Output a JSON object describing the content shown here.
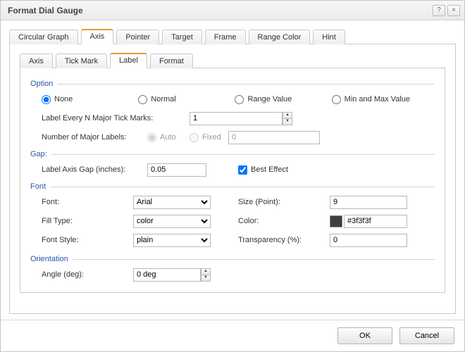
{
  "window": {
    "title": "Format Dial Gauge",
    "help_glyph": "?",
    "close_glyph": "×"
  },
  "main_tabs": [
    {
      "label": "Circular Graph"
    },
    {
      "label": "Axis",
      "selected": true
    },
    {
      "label": "Pointer"
    },
    {
      "label": "Target"
    },
    {
      "label": "Frame"
    },
    {
      "label": "Range Color"
    },
    {
      "label": "Hint"
    }
  ],
  "sub_tabs": [
    {
      "label": "Axis"
    },
    {
      "label": "Tick Mark"
    },
    {
      "label": "Label",
      "selected": true
    },
    {
      "label": "Format"
    }
  ],
  "groups": {
    "option": "Option",
    "gap": "Gap:",
    "font": "Font",
    "orientation": "Orientation"
  },
  "option": {
    "radios": {
      "none": "None",
      "normal": "Normal",
      "range_value": "Range Value",
      "min_max": "Min and Max Value"
    },
    "label_every": "Label Every N Major Tick Marks:",
    "label_every_value": "1",
    "num_major": "Number of Major Labels:",
    "auto": "Auto",
    "fixed": "Fixed",
    "fixed_value": "0"
  },
  "gap": {
    "label": "Label Axis Gap (inches):",
    "value": "0.05",
    "best_effect": "Best Effect"
  },
  "font": {
    "font_label": "Font:",
    "font_value": "Arial",
    "fill_type_label": "Fill Type:",
    "fill_type_value": "color",
    "font_style_label": "Font Style:",
    "font_style_value": "plain",
    "size_label": "Size (Point):",
    "size_value": "9",
    "color_label": "Color:",
    "color_value": "#3f3f3f",
    "transparency_label": "Transparency (%):",
    "transparency_value": "0"
  },
  "orientation": {
    "angle_label": "Angle (deg):",
    "angle_value": "0 deg"
  },
  "buttons": {
    "ok": "OK",
    "cancel": "Cancel"
  }
}
